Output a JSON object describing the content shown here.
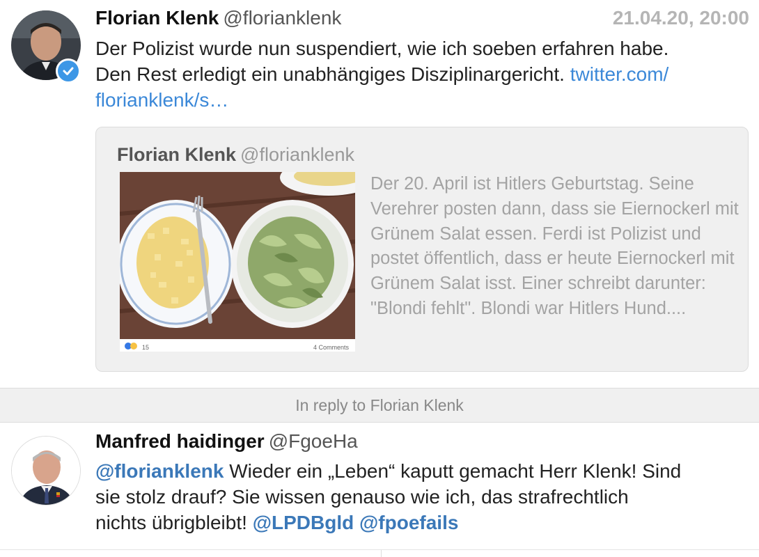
{
  "tweet1": {
    "name": "Florian Klenk",
    "handle": "@florianklenk",
    "timestamp": "21.04.20, 20:00",
    "text_line1": "Der Polizist wurde nun suspendiert, wie ich soeben erfahren habe.",
    "text_line2": "Den Rest erledigt ein unabhängiges Disziplinargericht.",
    "link_part1": "twitter.com/",
    "link_part2": "florianklenk/s…",
    "avatar_icon": "person-avatar",
    "verified_icon": "verified-badge-icon",
    "accent_color": "#3b88d8"
  },
  "quoted": {
    "name": "Florian Klenk",
    "handle": "@florianklenk",
    "text": "Der 20. April ist Hitlers Geburtstag. Seine Verehrer posten dann, dass sie Eiernockerl mit Grünem Salat essen. Ferdi ist Polizist und postet öffentlich, dass er heute Eiernockerl mit Grünem Salat isst. Einer schreibt darunter: \"Blondi fehlt\". Blondi war Hitlers Hund....",
    "image": {
      "reaction_count": "15",
      "comments": "4 Comments"
    }
  },
  "reply_bar": {
    "label": "In reply to Florian Klenk"
  },
  "tweet2": {
    "name": "Manfred haidinger",
    "handle": "@FgoeHa",
    "mention1": "@florianklenk",
    "text_a": " Wieder ein „Leben“ kaputt gemacht Herr Klenk! Sind",
    "text_b": "sie stolz drauf? Sie wissen genauso wie ich, das strafrechtlich",
    "text_c": "nichts übrigbleibt! ",
    "mention2": "@LPDBgld",
    "mention3": "@fpoefails",
    "avatar_icon": "person-avatar",
    "mention_color": "#3b78b8"
  }
}
